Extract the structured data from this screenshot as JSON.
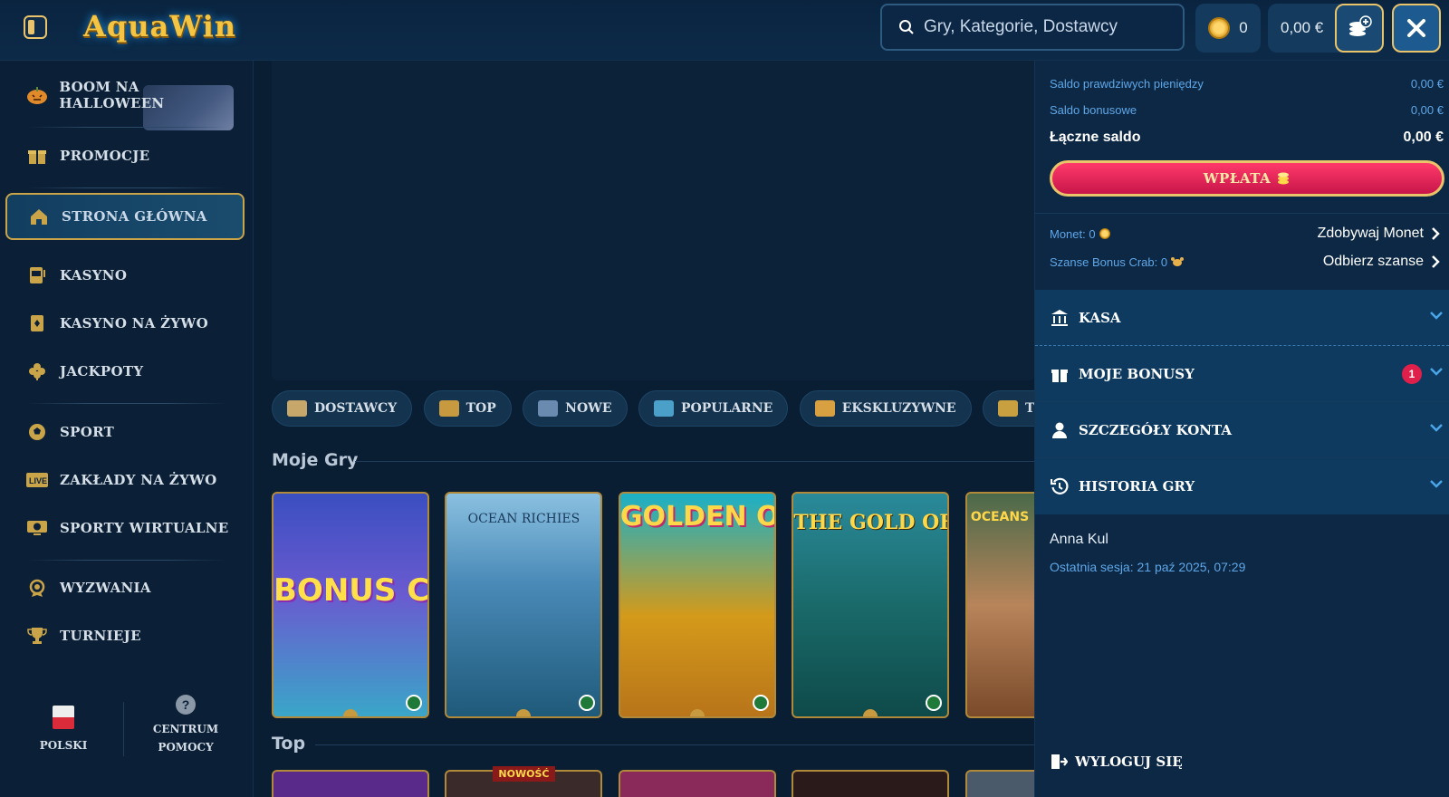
{
  "header": {
    "logo_text": "AquaWin",
    "search_placeholder": "Gry, Kategorie, Dostawcy",
    "coins": "0",
    "balance": "0,00 €"
  },
  "sidebar": {
    "items": [
      {
        "label": "BOOM NA HALLOWEEN",
        "icon": "pumpkin-icon"
      },
      {
        "label": "PROMOCJE",
        "icon": "gift-icon"
      },
      {
        "label": "STRONA GŁÓWNA",
        "icon": "home-icon",
        "active": true
      },
      {
        "label": "KASYNO",
        "icon": "slot-machine-icon"
      },
      {
        "label": "KASYNO NA ŻYWO",
        "icon": "card-icon"
      },
      {
        "label": "JACKPOTY",
        "icon": "clover-icon"
      },
      {
        "label": "SPORT",
        "icon": "soccer-ball-icon"
      },
      {
        "label": "ZAKŁADY NA ŻYWO",
        "icon": "live-icon"
      },
      {
        "label": "SPORTY WIRTUALNE",
        "icon": "virtual-sports-icon"
      },
      {
        "label": "WYZWANIA",
        "icon": "medal-icon"
      },
      {
        "label": "TURNIEJE",
        "icon": "trophy-icon"
      }
    ],
    "language": "POLSKI",
    "help_line1": "CENTRUM",
    "help_line2": "POMOCY"
  },
  "main": {
    "chips": [
      {
        "label": "DOSTAWCY",
        "color": "#c8a86a"
      },
      {
        "label": "TOP",
        "color": "#c89a40"
      },
      {
        "label": "NOWE",
        "color": "#6a8ab0"
      },
      {
        "label": "POPULARNE",
        "color": "#4aa0c8"
      },
      {
        "label": "EKSKLUZYWNE",
        "color": "#d8a040"
      },
      {
        "label": "TOP KASYNO",
        "color": "#c8a040"
      }
    ],
    "my_games_title": "Moje Gry",
    "games": [
      {
        "title": "BONUS CRAB"
      },
      {
        "title": "OCEAN RICHIES"
      },
      {
        "title": "GOLDEN OCTOPUS"
      },
      {
        "title": "THE GOLD OF POSEIDON"
      },
      {
        "title": "OCEANS"
      }
    ],
    "top_title": "Top",
    "new_badge": "NOWOŚĆ"
  },
  "panel": {
    "real_money_label": "Saldo prawdziwych pieniędzy",
    "real_money_value": "0,00 €",
    "bonus_label": "Saldo bonusowe",
    "bonus_value": "0,00 €",
    "total_label": "Łączne saldo",
    "total_value": "0,00 €",
    "deposit_label": "WPŁATA",
    "coins_label": "Monet: 0",
    "coins_link": "Zdobywaj Monet",
    "crab_label": "Szanse Bonus Crab: 0",
    "crab_link": "Odbierz szanse",
    "sections": [
      {
        "label": "KASA",
        "icon": "bank-icon"
      },
      {
        "label": "MOJE BONUSY",
        "icon": "gift-icon",
        "badge": "1"
      },
      {
        "label": "SZCZEGÓŁY KONTA",
        "icon": "user-icon"
      },
      {
        "label": "HISTORIA GRY",
        "icon": "history-icon"
      }
    ],
    "user_name": "Anna Kul",
    "last_session": "Ostatnia sesja: 21 paź 2025, 07:29",
    "logout_label": "WYLOGUJ SIĘ"
  },
  "colors": {
    "accent_gold": "#e9c46a",
    "link_blue": "#5fa7e8",
    "deposit_red": "#e0204a",
    "background": "#0a1e33"
  }
}
